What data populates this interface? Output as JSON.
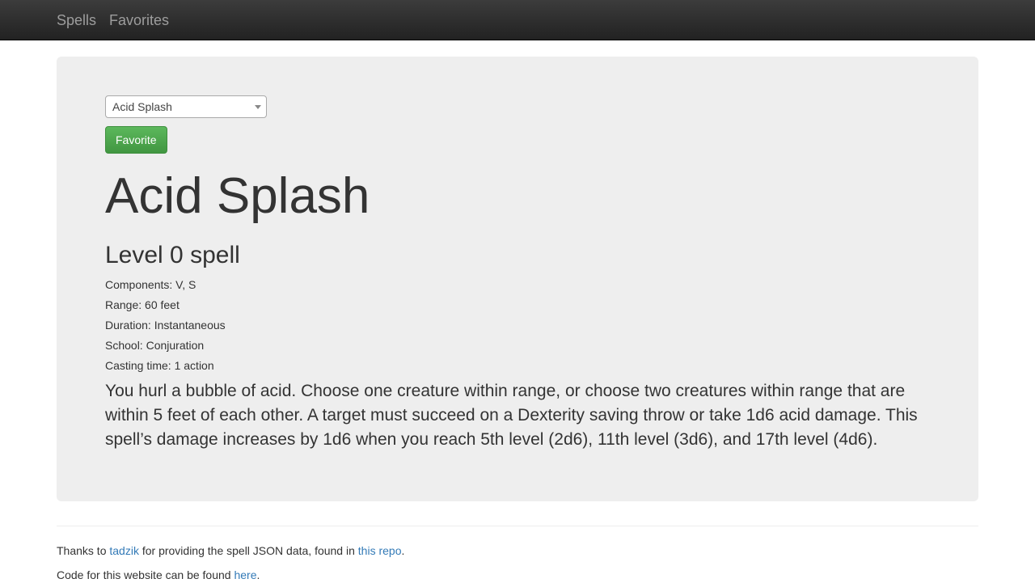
{
  "nav": {
    "items": [
      {
        "label": "Spells"
      },
      {
        "label": "Favorites"
      }
    ]
  },
  "spell_select": {
    "value": "Acid Splash"
  },
  "favorite_button": {
    "label": "Favorite"
  },
  "spell": {
    "name": "Acid Splash",
    "level": "Level 0 spell",
    "components": "Components: V, S",
    "range": "Range: 60 feet",
    "duration": "Duration: Instantaneous",
    "school": "School: Conjuration",
    "casting_time": "Casting time: 1 action",
    "description": "You hurl a bubble of acid. Choose one creature within range, or choose two creatures within range that are within 5 feet of each other. A target must succeed on a Dexterity saving throw or take 1d6 acid damage. This spell’s damage increases by 1d6 when you reach 5th level (2d6), 11th level (3d6), and 17th level (4d6)."
  },
  "footer": {
    "line1_prefix": "Thanks to ",
    "line1_link1": "tadzik",
    "line1_middle": " for providing the spell JSON data, found in ",
    "line1_link2": "this repo",
    "line1_suffix": ".",
    "line2_prefix": "Code for this website can be found ",
    "line2_link": "here",
    "line2_suffix": "."
  }
}
